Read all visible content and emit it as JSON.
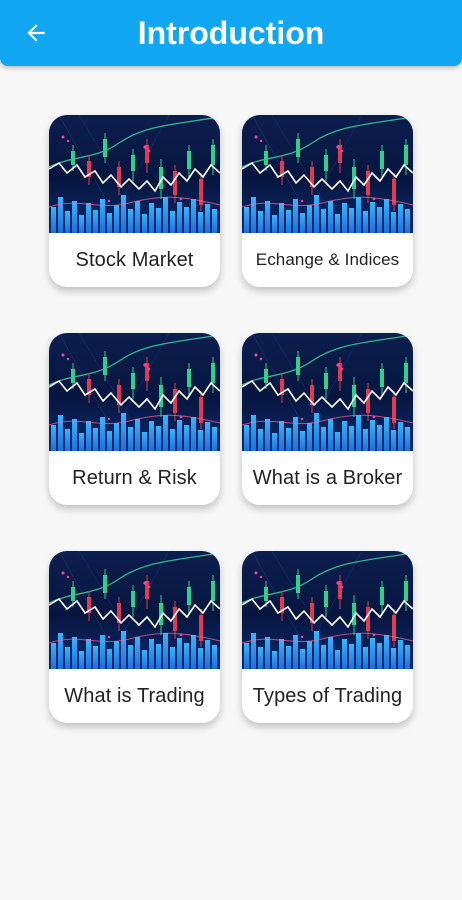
{
  "header": {
    "title": "Introduction",
    "back_icon": "arrow-left-icon"
  },
  "colors": {
    "appbar": "#10a6f2",
    "background": "#f7f7f8"
  },
  "topics": [
    {
      "label": "Stock Market",
      "image": "stock-chart-image"
    },
    {
      "label": "Echange & Indices",
      "image": "stock-chart-image"
    },
    {
      "label": "Return & Risk",
      "image": "stock-chart-image"
    },
    {
      "label": "What is a Broker",
      "image": "stock-chart-image"
    },
    {
      "label": "What is Trading",
      "image": "stock-chart-image"
    },
    {
      "label": "Types of Trading",
      "image": "stock-chart-image"
    }
  ]
}
